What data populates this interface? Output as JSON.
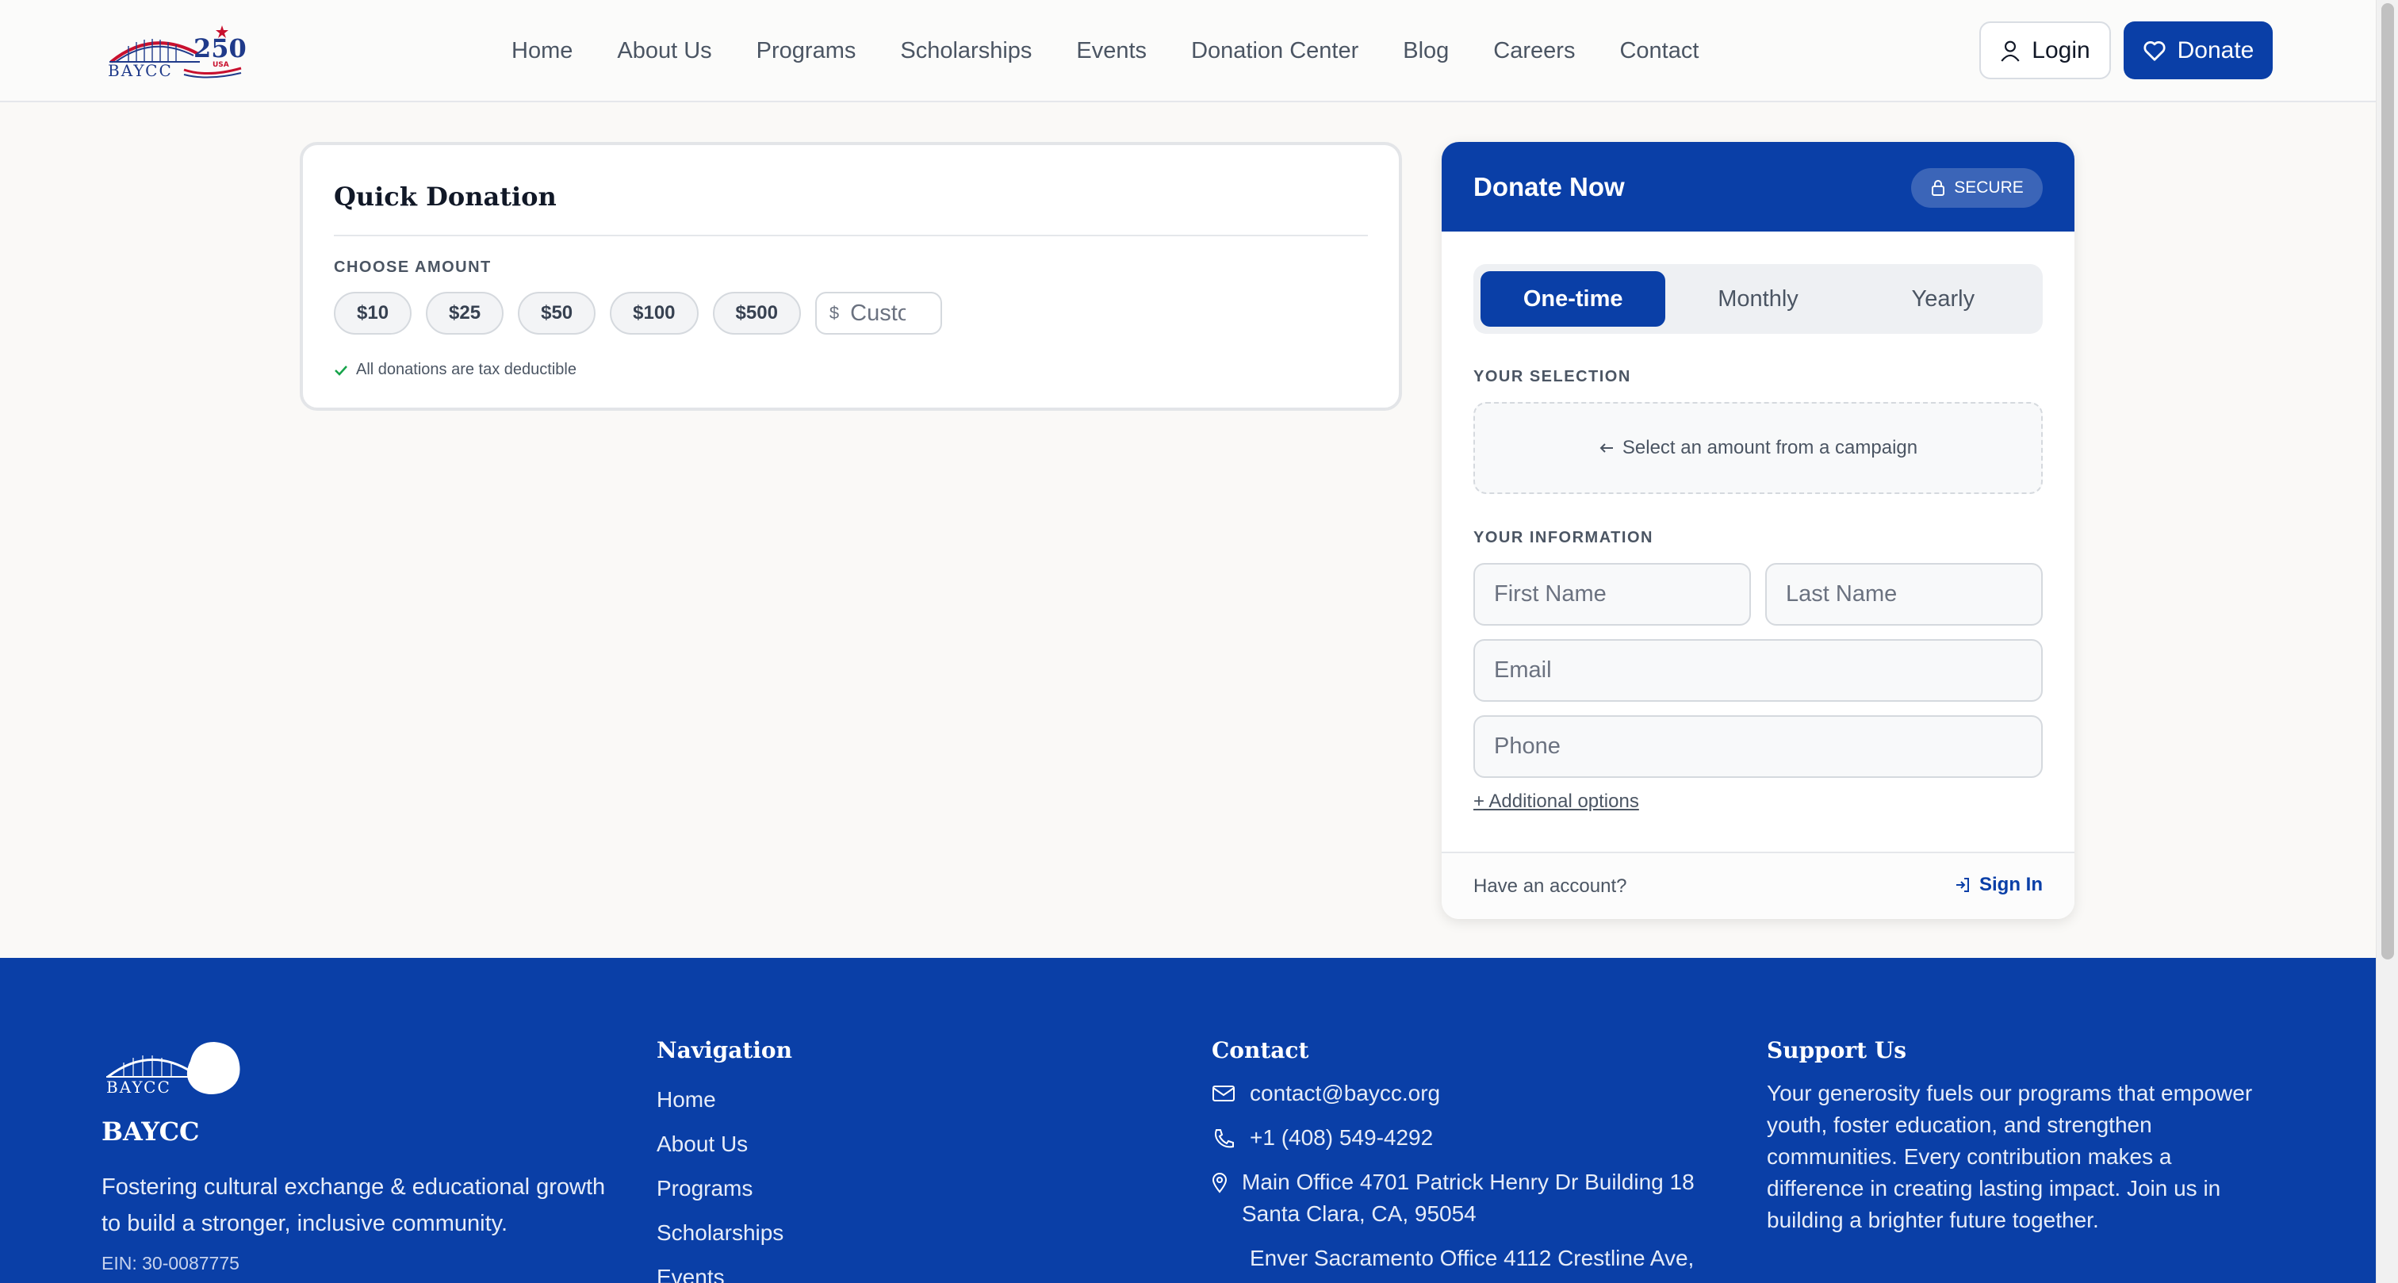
{
  "brand": {
    "logo_text": "BAYCC",
    "logo_badge": "250",
    "logo_badge_sub": "USA"
  },
  "nav": {
    "items": [
      "Home",
      "About Us",
      "Programs",
      "Scholarships",
      "Events",
      "Donation Center",
      "Blog",
      "Careers",
      "Contact"
    ],
    "login_label": "Login",
    "donate_label": "Donate"
  },
  "quick_donation": {
    "title": "Quick Donation",
    "choose_label": "CHOOSE AMOUNT",
    "amounts": [
      "$10",
      "$25",
      "$50",
      "$100",
      "$500"
    ],
    "custom_currency": "$",
    "custom_placeholder": "Custom",
    "tax_note": "All donations are tax deductible"
  },
  "donate_now": {
    "title": "Donate Now",
    "secure_label": "SECURE",
    "frequencies": [
      "One-time",
      "Monthly",
      "Yearly"
    ],
    "active_frequency": "One-time",
    "selection_label": "YOUR SELECTION",
    "selection_hint": "Select an amount from a campaign",
    "info_label": "YOUR INFORMATION",
    "first_name_placeholder": "First Name",
    "last_name_placeholder": "Last Name",
    "email_placeholder": "Email",
    "phone_placeholder": "Phone",
    "additional_options": "+ Additional options",
    "have_account": "Have an account?",
    "sign_in": "Sign In"
  },
  "footer": {
    "brand": "BAYCC",
    "tagline": "Fostering cultural exchange & educational growth to build a stronger, inclusive community.",
    "ein": "EIN: 30-0087775",
    "navigation_heading": "Navigation",
    "navigation_links": [
      "Home",
      "About Us",
      "Programs",
      "Scholarships",
      "Events"
    ],
    "contact_heading": "Contact",
    "email": "contact@baycc.org",
    "phone": "+1 (408) 549-4292",
    "main_office": "Main Office 4701 Patrick Henry Dr Building 18 Santa Clara, CA, 95054",
    "sacramento_office": "Enver Sacramento Office 4112 Crestline Ave,",
    "support_heading": "Support Us",
    "support_text": "Your generosity fuels our programs that empower youth, foster education, and strengthen communities. Every contribution makes a difference in creating lasting impact. Join us in building a brighter future together."
  },
  "colors": {
    "brand_blue": "#0a3fa7",
    "success_green": "#16a34a",
    "logo_red": "#c8102e"
  }
}
